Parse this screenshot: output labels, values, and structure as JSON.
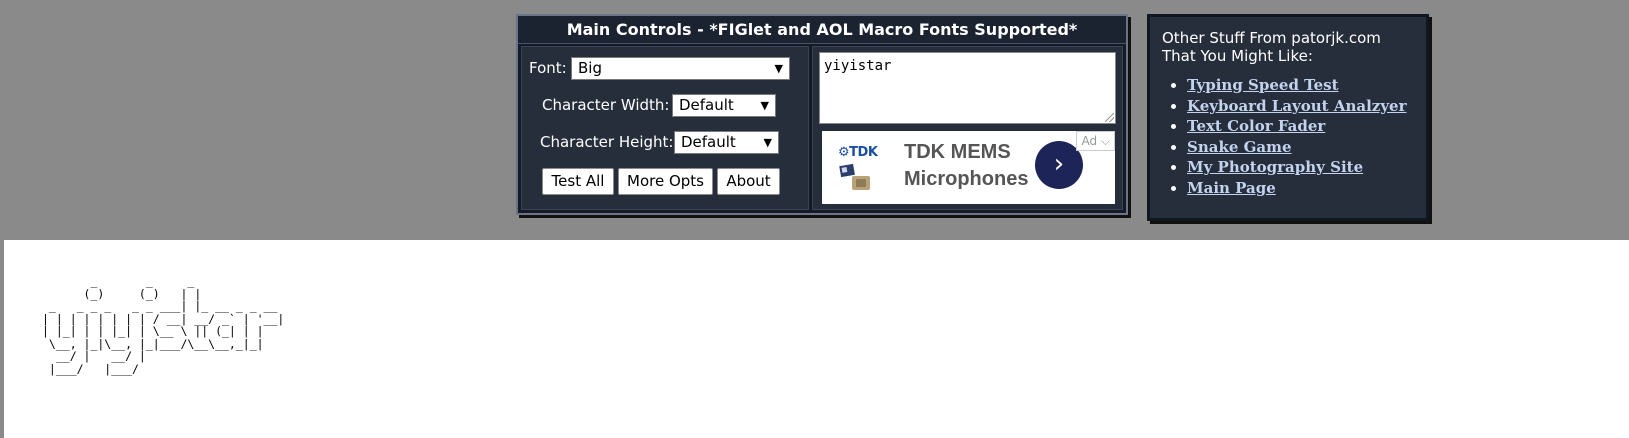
{
  "main_controls": {
    "title": "Main Controls - *FIGlet and AOL Macro Fonts Supported*",
    "font_label": "Font:",
    "font_value": "Big",
    "char_width_label": "Character Width:",
    "char_width_value": "Default",
    "char_height_label": "Character Height:",
    "char_height_value": "Default",
    "buttons": {
      "test_all": "Test All",
      "more_opts": "More Opts",
      "about": "About"
    },
    "input_text": "yiyistar",
    "dropdown_arrow": "▼"
  },
  "ad": {
    "logo_text": "⚙TDK",
    "headline": "TDK MEMS Microphones",
    "arrow": "›",
    "badge": "Ad ⌵"
  },
  "other_stuff": {
    "title": "Other Stuff From patorjk.com That You Might Like:",
    "links": [
      "Typing Speed Test",
      "Keyboard Layout Analzyer",
      "Text Color Fader",
      "Snake Game",
      "My Photography Site",
      "Main Page"
    ]
  },
  "output": {
    "ascii_art": "       _       _     _             \n      (_)     (_)   | |            \n _   _ _ _   _ _ ___| |_ __ _ _ __ \n| | | | | | | | / __| __/ _` | '__|\n| |_| | | |_| | \\__ \\ || (_| | |   \n \\__, |_|\\__, |_|___/\\__\\__,_|_|   \n  __/ |   __/ |                    \n |___/   |___/                     "
  }
}
